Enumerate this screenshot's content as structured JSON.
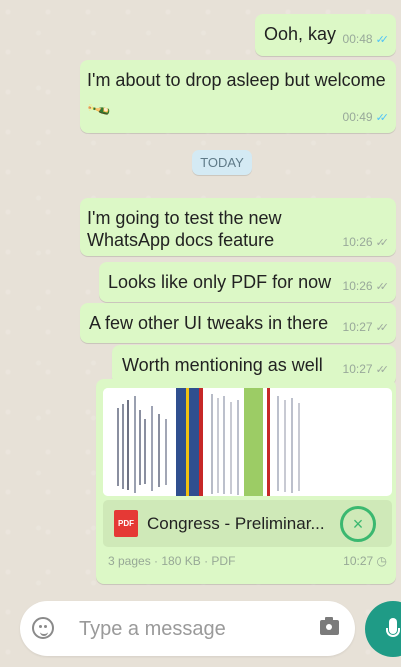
{
  "messages": [
    {
      "text": "Ooh, kay",
      "time": "00:48",
      "status": "read"
    },
    {
      "text": "I'm about to drop asleep but welcome",
      "emoji": "🍾",
      "time": "00:49",
      "status": "read"
    },
    {
      "text": "I'm going to test the new WhatsApp docs feature",
      "time": "10:26",
      "status": "sent"
    },
    {
      "text": "Looks like only PDF for now",
      "time": "10:26",
      "status": "sent"
    },
    {
      "text": "A few other UI tweaks in there",
      "time": "10:27",
      "status": "sent"
    },
    {
      "text": "Worth mentioning as well",
      "time": "10:27",
      "status": "sent"
    }
  ],
  "date_divider": "TODAY",
  "document": {
    "icon_label": "PDF",
    "name": "Congress - Preliminar...",
    "meta": "3 pages · 180 KB · PDF",
    "time": "10:27"
  },
  "composer": {
    "placeholder": "Type a message"
  },
  "icons": {
    "emoji": "emoji-icon",
    "camera": "camera-icon",
    "mic": "mic-icon",
    "cancel": "cancel-icon",
    "ticks_read": "double-check-icon",
    "ticks_sent": "double-check-icon",
    "clock": "clock-icon"
  },
  "colors": {
    "bubble": "#dcf8c6",
    "accent": "#1f9b86",
    "read_ticks": "#4fc3f7"
  }
}
